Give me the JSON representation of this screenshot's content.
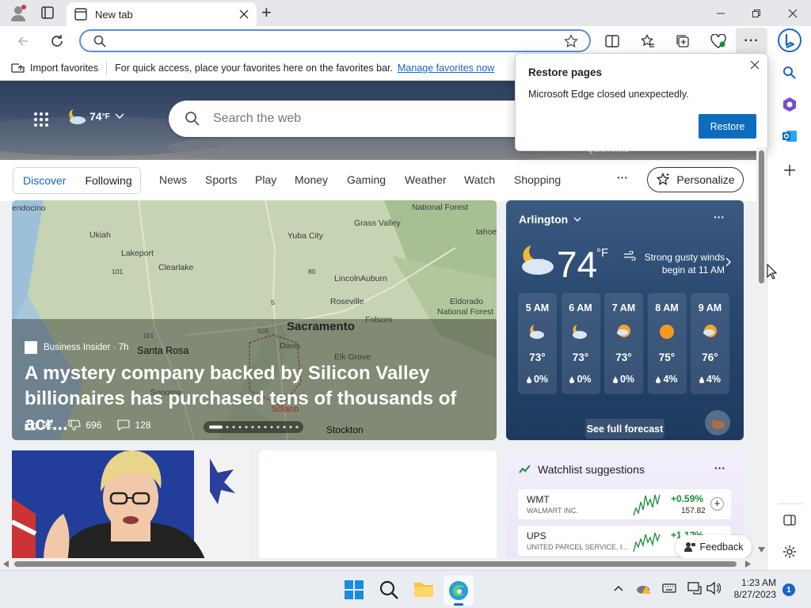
{
  "browser": {
    "tab_title": "New tab",
    "new_tab_symbol": "+",
    "favorites_bar": {
      "import_label": "Import favorites",
      "message": "For quick access, place your favorites here on the favorites bar.",
      "link": "Manage favorites now"
    }
  },
  "popup": {
    "title": "Restore pages",
    "message": "Microsoft Edge closed unexpectedly.",
    "button": "Restore",
    "behind_text": "Quick links"
  },
  "newtab": {
    "weather_temp": "74",
    "weather_unit": "°F",
    "search_placeholder": "Search the web",
    "tabs": [
      "Discover",
      "Following"
    ],
    "nav": [
      "News",
      "Sports",
      "Play",
      "Money",
      "Gaming",
      "Weather",
      "Watch",
      "Shopping"
    ],
    "more": "···",
    "personalize": "Personalize"
  },
  "map_card": {
    "labels": [
      "endocino",
      "Ukiah",
      "Lakeport",
      "Clearlake",
      "Yuba City",
      "Grass Valley",
      "National Forest",
      "tahoe",
      "Lincoln",
      "Auburn",
      "Roseville",
      "Folsom",
      "Eldorado",
      "National Forest",
      "Sacramento",
      "Santa Rosa",
      "Davis",
      "Elk Grove",
      "Solano",
      "Sonoma",
      "Stockton",
      "101",
      "101",
      "5",
      "505",
      "80"
    ],
    "source": "Business Insider · 7h",
    "headline": "A mystery company backed by Silicon Valley billionaires has purchased tens of thousands of acr...",
    "likes": "92",
    "dislikes": "696",
    "comments": "128"
  },
  "weather_card": {
    "location": "Arlington",
    "temp": "74",
    "unit": "°F",
    "alert": "Strong gusty winds begin at 11 AM",
    "hours": [
      {
        "time": "5 AM",
        "temp": "73°",
        "precip": "0%",
        "icon": "moon-cloud-icon"
      },
      {
        "time": "6 AM",
        "temp": "73°",
        "precip": "0%",
        "icon": "moon-cloud-icon"
      },
      {
        "time": "7 AM",
        "temp": "73°",
        "precip": "0%",
        "icon": "sun-cloud-icon"
      },
      {
        "time": "8 AM",
        "temp": "75°",
        "precip": "4%",
        "icon": "sun-icon"
      },
      {
        "time": "9 AM",
        "temp": "76°",
        "precip": "4%",
        "icon": "sun-cloud-icon"
      }
    ],
    "forecast_link": "See full forecast"
  },
  "watchlist": {
    "title": "Watchlist suggestions",
    "stocks": [
      {
        "symbol": "WMT",
        "name": "WALMART INC.",
        "change": "+0.59%",
        "price": "157.82"
      },
      {
        "symbol": "UPS",
        "name": "UNITED PARCEL SERVICE, I...",
        "change": "+1.12%",
        "price": ""
      }
    ],
    "feedback": "Feedback"
  },
  "taskbar": {
    "time": "1:23 AM",
    "date": "8/27/2023",
    "badge": "1"
  },
  "colors": {
    "accent": "#0f6cbd",
    "link": "#1a64c8",
    "stock_up": "#1d8a3a"
  }
}
